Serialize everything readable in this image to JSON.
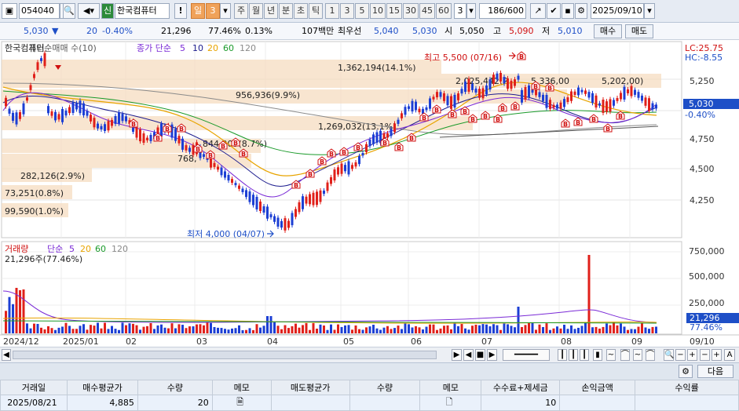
{
  "toolbar": {
    "code": "054040",
    "badge": "신",
    "name": "한국컴퓨터",
    "excl": "!",
    "period_sel": "일",
    "period_num": "3",
    "periods": [
      "주",
      "월",
      "년",
      "분",
      "초",
      "틱"
    ],
    "nums": [
      "1",
      "3",
      "5",
      "10",
      "15",
      "30",
      "45",
      "60"
    ],
    "n3": "3",
    "count": "186",
    "total": "/600",
    "date": "2025/09/10"
  },
  "quote": {
    "price": "5,030",
    "arrow": "▼",
    "change": "20",
    "change_pct": "-0.40%",
    "volume": "21,296",
    "vol_ratio": "77.46%",
    "turnover": "0.13%",
    "amount": "107백만",
    "best_label": "최우선",
    "ask": "5,040",
    "bid": "5,030",
    "open_label": "시",
    "open": "5,050",
    "high_label": "고",
    "high": "5,090",
    "low_label": "저",
    "low": "5,010",
    "buy_btn": "매수",
    "sell_btn": "매도"
  },
  "price_chart": {
    "legend_name": "한국컴퓨터",
    "legend_name_b": "개인순매매 수(10)",
    "legend_ma": "종가 단순",
    "ma_periods": [
      "5",
      "10",
      "20",
      "60",
      "120"
    ],
    "lc": "LC:25.75",
    "hc": "HC:-8.55",
    "yticks": [
      "5,250",
      "5,000",
      "4,750",
      "4,500",
      "4,250"
    ],
    "current_price": "5,030",
    "current_pct": "-0.40%",
    "max_label": "최고 5,500 (07/16)",
    "min_label": "최저 4,000 (04/07)",
    "profile": [
      {
        "label": "1,362,194(14.1%)"
      },
      {
        "label": "2,025,442(2"
      },
      {
        "label": "5,336,00"
      },
      {
        "label": "5,202,00)"
      },
      {
        "label": "956,936(9.9%)"
      },
      {
        "label": "1,269,032(13.1%)"
      },
      {
        "label": "844,209(8.7%)"
      },
      {
        "label": "768,"
      },
      {
        "label": "282,126(2.9%)"
      },
      {
        "label": "73,251(0.8%)"
      },
      {
        "label": "99,590(1.0%)"
      }
    ],
    "colors": {
      "up": "#e0201a",
      "down": "#1c3fd4",
      "ma5": "#7a2ad6",
      "ma10": "#1c1c8e",
      "ma20": "#e8a400",
      "ma60": "#1a9a2a",
      "ma120": "#8a8a8a",
      "profile": "#f5dcc0"
    }
  },
  "volume_chart": {
    "legend": "거래량",
    "legend_ma": "단순",
    "ma_periods": [
      "5",
      "20",
      "60",
      "120"
    ],
    "subtitle": "21,296주(77.46%)",
    "yticks": [
      "750,000",
      "500,000",
      "250,000"
    ],
    "cur_vol": "21,296",
    "cur_pct": "77.46%"
  },
  "xaxis": [
    "2024/12",
    "2025/01",
    "02",
    "03",
    "04",
    "05",
    "06",
    "07",
    "08",
    "09",
    "09/10"
  ],
  "nav": {
    "next_btn": "다음"
  },
  "table": {
    "headers": [
      "거래일",
      "매수평균가",
      "수량",
      "메모",
      "매도평균가",
      "수량",
      "메모",
      "수수료+제세금",
      "손익금액",
      "수익률"
    ],
    "row": [
      "2025/08/21",
      "4,885",
      "20",
      "",
      "",
      "",
      "",
      "10",
      "",
      ""
    ]
  }
}
